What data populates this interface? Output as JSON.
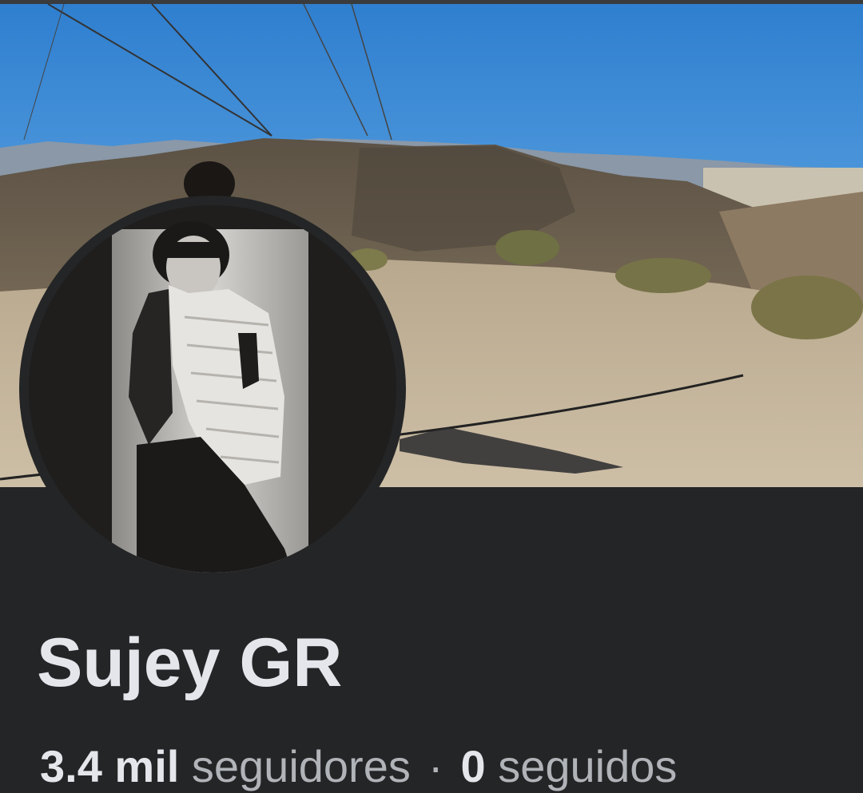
{
  "profile": {
    "name": "Sujey GR",
    "followers_count": "3.4 mil",
    "followers_label": "seguidores",
    "separator": "·",
    "following_count": "0",
    "following_label": "seguidos"
  },
  "cover_photo": {
    "description_icon": "landscape-photo"
  },
  "profile_photo": {
    "description_icon": "portrait-photo"
  },
  "colors": {
    "background": "#242526",
    "primary_text": "#e4e6eb",
    "secondary_text": "#b0b3b8"
  }
}
